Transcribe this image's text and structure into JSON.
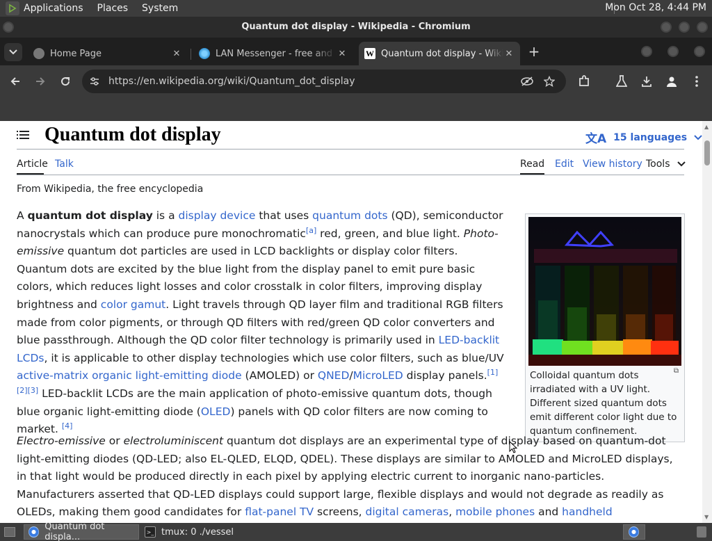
{
  "top_panel": {
    "menus": [
      "Applications",
      "Places",
      "System"
    ],
    "clock": "Mon Oct 28,  4:44 PM"
  },
  "window": {
    "title": "Quantum dot display - Wikipedia - Chromium"
  },
  "tabs": [
    {
      "title": "Home Page",
      "icon": "globe-icon"
    },
    {
      "title": "LAN Messenger - free and open",
      "icon": "lan-messenger-icon"
    },
    {
      "title": "Quantum dot display - Wikipedia",
      "icon": "wikipedia-icon"
    }
  ],
  "toolbar": {
    "url": "https://en.wikipedia.org/wiki/Quantum_dot_display"
  },
  "article": {
    "title": "Quantum dot display",
    "languages": "15 languages",
    "tab_article": "Article",
    "tab_talk": "Talk",
    "tab_read": "Read",
    "tab_edit": "Edit",
    "tab_history": "View history",
    "tab_tools": "Tools",
    "tagline": "From Wikipedia, the free encyclopedia",
    "p1": [
      "A ",
      "quantum dot display",
      " is a ",
      "display device",
      " that uses ",
      "quantum dots",
      " (QD), semiconductor nanocrystals which can produce pure monochromatic",
      "[a]",
      " red, green, and blue light. ",
      "Photo-emissive",
      " quantum dot particles are used in LCD backlights or display color filters. Quantum dots are excited by the blue light from the display panel to emit pure basic colors, which reduces light losses and color crosstalk in color filters, improving display brightness and ",
      "color gamut",
      ". Light travels through QD layer film and traditional RGB filters made from color pigments, or through QD filters with red/green QD color converters and blue passthrough. Although the QD color filter technology is primarily used in ",
      "LED-backlit LCDs",
      ", it is applicable to other display technologies which use color filters, such as blue/UV ",
      "active-matrix organic light-emitting diode",
      " (AMOLED) or ",
      "QNED",
      "/",
      "MicroLED",
      " display panels.",
      "[1]",
      "[2]",
      "[3]",
      " LED-backlit LCDs are the main application of photo-emissive quantum dots, though blue organic light-emitting diode (",
      "OLED",
      ") panels with QD color filters are now coming to market. ",
      "[4]"
    ],
    "p2": [
      "Electro-emissive",
      " or ",
      "electroluminiscent",
      " quantum dot displays are an experimental type of display based on quantum-dot light-emitting diodes (QD-LED; also EL-QLED, ELQD, QDEL). These displays are similar to AMOLED and MicroLED displays, in that light would be produced directly in each pixel by applying electric current to inorganic nano-particles. Manufacturers asserted that QD-LED displays could support large, flexible displays and would not degrade as readily as OLEDs, making them good candidates for ",
      "flat-panel TV",
      " screens, ",
      "digital cameras",
      ", ",
      "mobile phones",
      " and ",
      "handheld"
    ],
    "caption": "Colloidal quantum dots irradiated with a UV light. Different sized quantum dots emit different color light due to quantum confinement."
  },
  "taskbar": [
    {
      "label": "Quantum dot displa...",
      "icon": "chromium-icon"
    },
    {
      "label": "tmux: 0 ./vessel",
      "icon": "terminal-icon"
    }
  ]
}
